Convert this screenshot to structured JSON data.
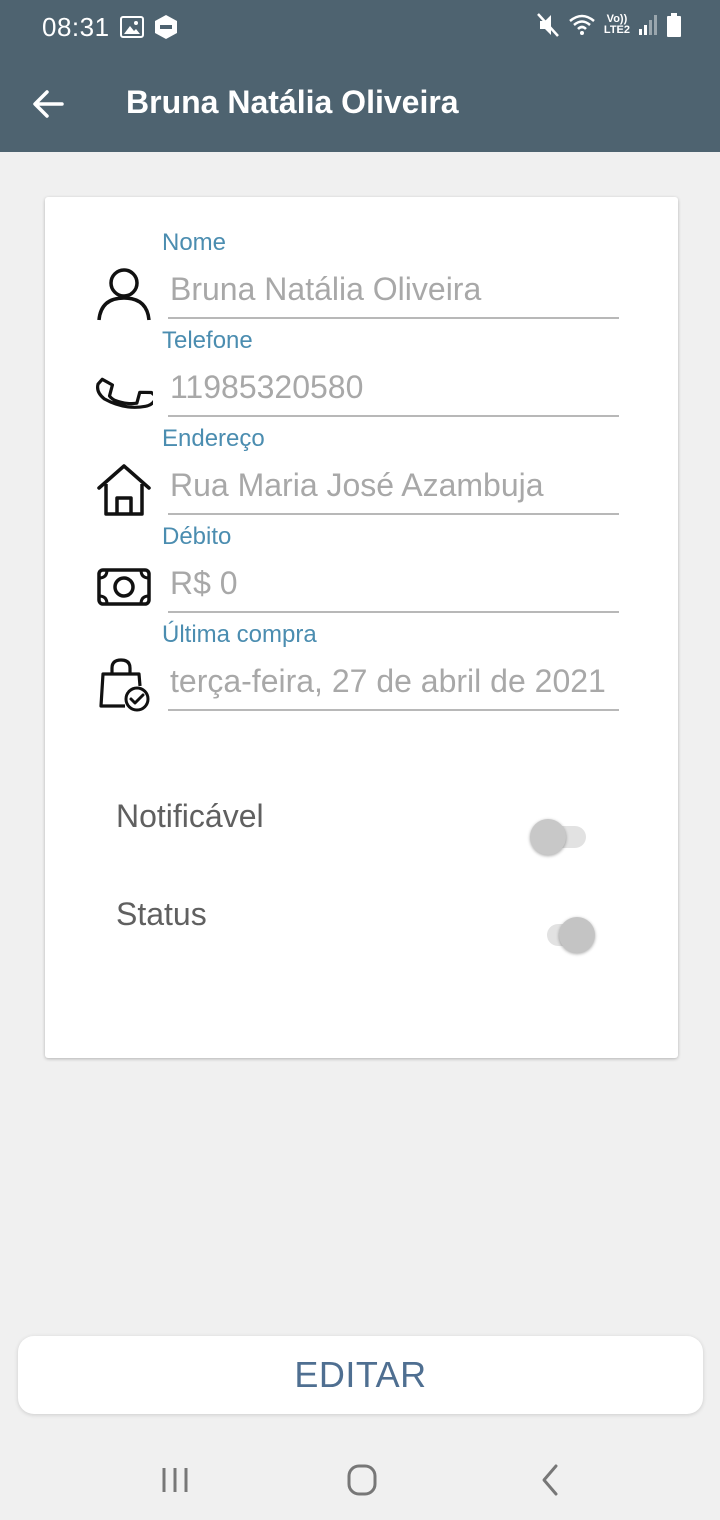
{
  "status_bar": {
    "time": "08:31",
    "lte_line1": "Vo))",
    "lte_line2": "LTE2",
    "icons": [
      "gallery-icon",
      "app-notification-icon",
      "mute-icon",
      "wifi-icon",
      "signal-icon",
      "battery-icon"
    ]
  },
  "appbar": {
    "title": "Bruna Natália Oliveira",
    "back_icon": "arrow-left-icon",
    "background": "#4e6370"
  },
  "fields": [
    {
      "label": "Nome",
      "value": "Bruna Natália Oliveira",
      "icon": "person-icon"
    },
    {
      "label": "Telefone",
      "value": "11985320580",
      "icon": "phone-icon"
    },
    {
      "label": "Endereço",
      "value": "Rua Maria José Azambuja",
      "icon": "house-icon"
    },
    {
      "label": "Débito",
      "value": "R$ 0",
      "icon": "money-icon"
    },
    {
      "label": "Última compra",
      "value": "terça-feira, 27 de abril de 2021",
      "icon": "shopping-bag-check-icon"
    }
  ],
  "switches": [
    {
      "label": "Notificável",
      "checked": false
    },
    {
      "label": "Status",
      "checked": true
    }
  ],
  "actions": {
    "edit_label": "EDITAR"
  },
  "colors": {
    "label": "#4b8db0",
    "button_text": "#4f6f91"
  },
  "navbar": {
    "icons": [
      "recent-apps-icon",
      "home-icon",
      "back-icon"
    ]
  }
}
